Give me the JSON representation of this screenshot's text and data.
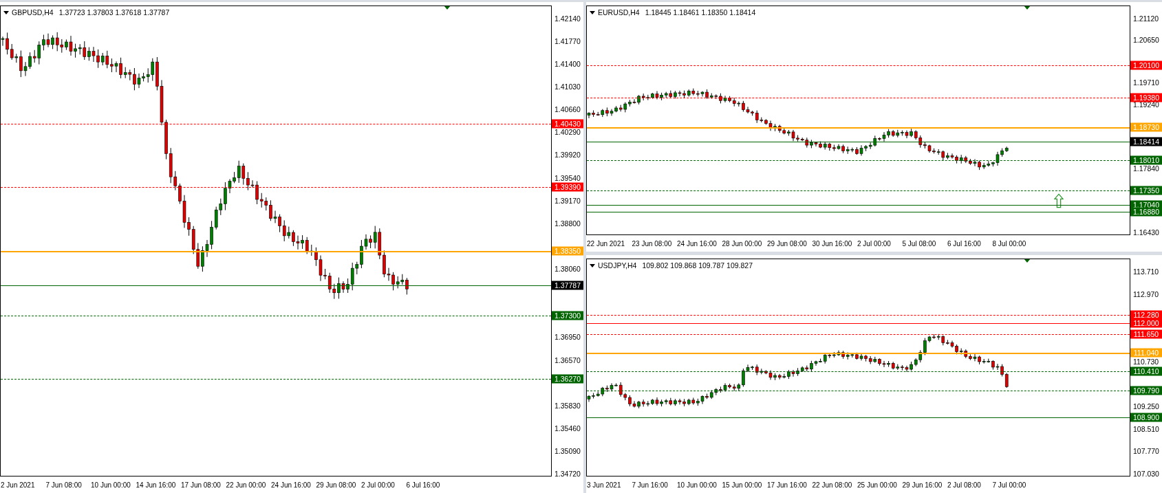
{
  "charts": [
    {
      "symbol": "GBPUSD,H4",
      "ohlc": "1.37723 1.37803 1.37618 1.37787",
      "price_ticks": [
        "1.42140",
        "1.41770",
        "1.41400",
        "1.41030",
        "1.40660",
        "1.40290",
        "1.39920",
        "1.39540",
        "1.39170",
        "1.38800",
        "1.38060",
        "1.36950",
        "1.36570",
        "1.35830",
        "1.35460",
        "1.35090",
        "1.34720"
      ],
      "time_labels": [
        "2 Jun 2021",
        "7 Jun 08:00",
        "10 Jun 00:00",
        "14 Jun 16:00",
        "17 Jun 08:00",
        "22 Jun 00:00",
        "24 Jun 16:00",
        "29 Jun 08:00",
        "2 Jul 00:00",
        "6 Jul 16:00"
      ],
      "levels": [
        {
          "price": "1.40430",
          "color": "#ff0000",
          "kind": "dashed"
        },
        {
          "price": "1.39390",
          "color": "#ff0000",
          "kind": "dashed"
        },
        {
          "price": "1.38350",
          "color": "#ffa500",
          "kind": "solid"
        },
        {
          "price": "1.37787",
          "color": "#000000",
          "kind": "current"
        },
        {
          "price": "1.37300",
          "color": "#006400",
          "kind": "dashed"
        },
        {
          "price": "1.36270",
          "color": "#006400",
          "kind": "dashed"
        }
      ]
    },
    {
      "symbol": "EURUSD,H4",
      "ohlc": "1.18445 1.18461 1.18350 1.18414",
      "price_ticks": [
        "1.21120",
        "1.20650",
        "1.19710",
        "1.19240",
        "1.17840",
        "1.16430"
      ],
      "time_labels": [
        "22 Jun 2021",
        "23 Jun 08:00",
        "24 Jun 16:00",
        "28 Jun 00:00",
        "29 Jun 08:00",
        "30 Jun 16:00",
        "2 Jul 00:00",
        "5 Jul 08:00",
        "6 Jul 16:00",
        "8 Jul 00:00"
      ],
      "levels": [
        {
          "price": "1.20100",
          "color": "#ff0000",
          "kind": "dashed"
        },
        {
          "price": "1.19380",
          "color": "#ff0000",
          "kind": "dashed"
        },
        {
          "price": "1.18730",
          "color": "#ffa500",
          "kind": "solid"
        },
        {
          "price": "1.18414",
          "color": "#000000",
          "kind": "current"
        },
        {
          "price": "1.18010",
          "color": "#006400",
          "kind": "dashed"
        },
        {
          "price": "1.17350",
          "color": "#006400",
          "kind": "dashed"
        },
        {
          "price": "1.17040",
          "color": "#006400",
          "kind": "solid"
        },
        {
          "price": "1.16880",
          "color": "#006400",
          "kind": "solid"
        }
      ],
      "arrow_marker": {
        "kind": "up"
      }
    },
    {
      "symbol": "USDJPY,H4",
      "ohlc": "109.802 109.868 109.787 109.827",
      "price_ticks": [
        "113.710",
        "112.970",
        "110.730",
        "109.250",
        "108.510",
        "107.770",
        "107.030"
      ],
      "time_labels": [
        "3 Jun 2021",
        "7 Jun 16:00",
        "10 Jun 00:00",
        "15 Jun 00:00",
        "17 Jun 16:00",
        "22 Jun 08:00",
        "25 Jun 00:00",
        "29 Jun 16:00",
        "2 Jul 08:00",
        "7 Jul 00:00"
      ],
      "levels": [
        {
          "price": "112.280",
          "color": "#ff0000",
          "kind": "dashed"
        },
        {
          "price": "112.000",
          "color": "#ff0000",
          "kind": "solid"
        },
        {
          "price": "111.650",
          "color": "#ff0000",
          "kind": "dashed"
        },
        {
          "price": "111.040",
          "color": "#ffa500",
          "kind": "solid"
        },
        {
          "price": "110.410",
          "color": "#006400",
          "kind": "dashed"
        },
        {
          "price": "109.790",
          "color": "#006400",
          "kind": "dashed"
        },
        {
          "price": "108.900",
          "color": "#006400",
          "kind": "solid"
        }
      ]
    }
  ]
}
